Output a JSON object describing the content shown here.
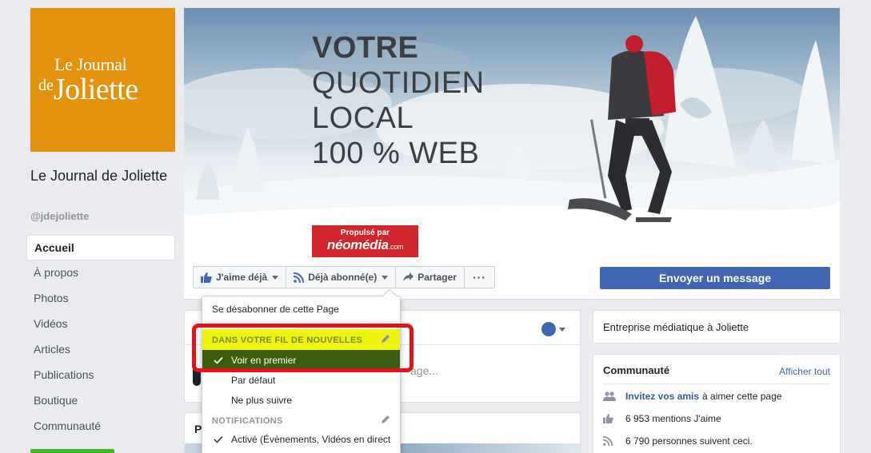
{
  "logo": {
    "line1": "Le Journal",
    "line2_small": "de",
    "line2_big": "Joliette",
    "bg": "#e4920c"
  },
  "page": {
    "name": "Le Journal de Joliette",
    "handle": "@jdejoliette"
  },
  "nav": {
    "items": [
      {
        "label": "Accueil"
      },
      {
        "label": "À propos"
      },
      {
        "label": "Photos"
      },
      {
        "label": "Vidéos"
      },
      {
        "label": "Articles"
      },
      {
        "label": "Publications"
      },
      {
        "label": "Boutique"
      },
      {
        "label": "Communauté"
      }
    ]
  },
  "cover": {
    "line1": "VOTRE",
    "line2": "QUOTIDIEN",
    "line3": "LOCAL",
    "line4": "100 % WEB",
    "badge_top": "Propulsé par",
    "badge_brand": "néomédia",
    "badge_suffix": ".com"
  },
  "actions": {
    "like": "J'aime déjà",
    "follow": "Déjà abonné(e)",
    "share": "Partager",
    "more": "···",
    "message": "Envoyer un message"
  },
  "dropdown": {
    "unsubscribe": "Se désabonner de cette Page",
    "feed_header": "DANS VOTRE FIL DE NOUVELLES",
    "see_first": "Voir en premier",
    "default": "Par défaut",
    "unfollow": "Ne plus suivre",
    "notif_header": "NOTIFICATIONS",
    "notif_active": "Activé (Évènements, Vidéos en direct"
  },
  "post": {
    "placeholder": "age..."
  },
  "photos": {
    "title": "Ph"
  },
  "about": {
    "category": "Entreprise médiatique à Joliette"
  },
  "community": {
    "title": "Communauté",
    "see_all": "Afficher tout",
    "invite_link": "Invitez vos amis",
    "invite_rest": "à aimer cette page",
    "likes": "6 953 mentions J'aime",
    "follows": "6 790 personnes suivent ceci."
  },
  "colors": {
    "fb_blue": "#4267b2",
    "highlight_yellow": "#eef20c",
    "highlight_green": "#3a5d0d",
    "annotation_red": "#e6101a"
  }
}
